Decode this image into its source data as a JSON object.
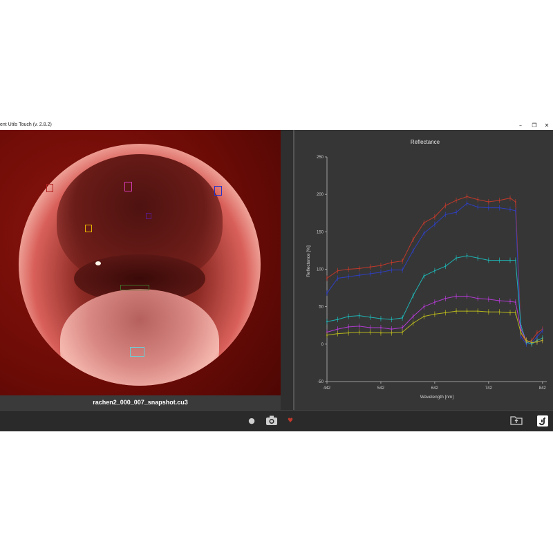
{
  "window": {
    "title": "ent Utils Touch (v. 2.8.2)",
    "minimize_glyph": "–",
    "restore_glyph": "❐",
    "close_glyph": "✕"
  },
  "image_panel": {
    "filename": "rachen2_000_007_snapshot.cu3",
    "roi_colors": {
      "red": "#b22222",
      "magenta": "#d23ab0",
      "blue": "#2233cc",
      "yellow": "#e6b400",
      "purple": "#5a1a8a",
      "green": "#3f6f2a",
      "cyan": "#6ad0d8"
    }
  },
  "toolbar": {
    "icons": [
      "record-icon",
      "camera-icon",
      "heart-icon",
      "folder-export-icon",
      "app-logo-icon"
    ]
  },
  "chart_data": {
    "type": "line",
    "title": "Reflectance",
    "xlabel": "Wavelength [nm]",
    "ylabel": "Reflectance [%]",
    "xlim": [
      442,
      850
    ],
    "ylim": [
      -50,
      250
    ],
    "x_ticks": [
      "442",
      "542",
      "642",
      "742",
      "842"
    ],
    "y_ticks": [
      "250",
      "200",
      "150",
      "100",
      "50",
      "0",
      "-50"
    ],
    "grid": false,
    "x": [
      442,
      462,
      482,
      502,
      522,
      542,
      562,
      582,
      602,
      622,
      642,
      662,
      682,
      702,
      722,
      742,
      762,
      782,
      792,
      802,
      812,
      822,
      832,
      842
    ],
    "series": [
      {
        "color": "#c0392b",
        "values": [
          88,
          98,
          100,
          101,
          103,
          105,
          109,
          111,
          140,
          162,
          170,
          185,
          192,
          197,
          193,
          190,
          192,
          195,
          190,
          15,
          2,
          5,
          15,
          20
        ]
      },
      {
        "color": "#2e3fbf",
        "values": [
          68,
          88,
          90,
          92,
          94,
          96,
          99,
          99,
          125,
          148,
          160,
          173,
          176,
          188,
          183,
          182,
          182,
          180,
          178,
          10,
          0,
          2,
          10,
          18
        ]
      },
      {
        "color": "#1fb3b3",
        "values": [
          30,
          33,
          37,
          38,
          36,
          34,
          33,
          35,
          65,
          91,
          98,
          104,
          115,
          118,
          115,
          112,
          112,
          112,
          112,
          25,
          3,
          0,
          5,
          8
        ]
      },
      {
        "color": "#b13bd1",
        "values": [
          16,
          20,
          23,
          24,
          22,
          22,
          20,
          22,
          37,
          50,
          56,
          61,
          64,
          64,
          61,
          60,
          58,
          57,
          56,
          20,
          5,
          2,
          3,
          5
        ]
      },
      {
        "color": "#b5b51e",
        "values": [
          12,
          14,
          15,
          16,
          16,
          15,
          15,
          16,
          28,
          37,
          40,
          42,
          44,
          44,
          44,
          43,
          43,
          42,
          42,
          15,
          5,
          2,
          3,
          5
        ]
      }
    ]
  }
}
